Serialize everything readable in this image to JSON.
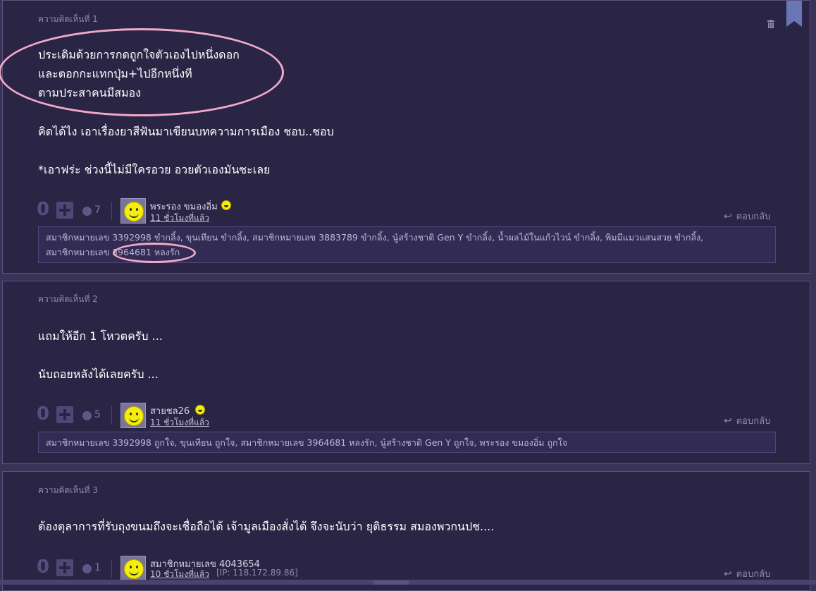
{
  "comments": [
    {
      "label": "ความคิดเห็นที่ 1",
      "lines": [
        "ประเดิมด้วยการกดถูกใจตัวเองไปหนึ่งดอก",
        "และตอกกะแทกปุ่ม+ไปอีกหนึ่งที",
        "ตามประสาคนมีสมอง",
        "คิดได้ไง เอาเรื่องยาสีฟันมาเขียนบทความการเมือง ชอบ..ชอบ",
        "*เอาฟร่ะ ช่วงนี้ไม่มีใครอวย อวยตัวเองมันซะเลย"
      ],
      "votes": "0",
      "emotion_count": "7",
      "username": "พระรอง ขมองอิ่ม",
      "time": "11 ชั่วโมงที่แล้ว",
      "reply_label": "ตอบกลับ",
      "emotion_list_line1": "สมาชิกหมายเลข 3392998 ขำกลิ้ง, ขุนเทียน ขำกลิ้ง, สมาชิกหมายเลข 3883789 ขำกลิ้ง, นู๋สร้างชาติ Gen Y ขำกลิ้ง, น้ำผลไม้ในแก้วไวน์ ขำกลิ้ง, พิมมีแมวแสนสวย ขำกลิ้ง,",
      "emotion_list_line2": "สมาชิกหมายเลข 3964681 หลงรัก"
    },
    {
      "label": "ความคิดเห็นที่ 2",
      "lines": [
        "แถมให้อีก 1 โหวตครับ ...",
        "นับถอยหลังได้เลยครับ ..."
      ],
      "votes": "0",
      "emotion_count": "5",
      "username": "สายชล26",
      "time": "11 ชั่วโมงที่แล้ว",
      "reply_label": "ตอบกลับ",
      "emotion_list_line1": "สมาชิกหมายเลข 3392998 ถูกใจ, ขุนเทียน ถูกใจ, สมาชิกหมายเลข 3964681 หลงรัก, นู๋สร้างชาติ Gen Y ถูกใจ, พระรอง ขมองอิ่ม ถูกใจ"
    },
    {
      "label": "ความคิดเห็นที่ 3",
      "lines": [
        "ต้องตุลาการที่รับถุงขนมถึงจะเชื่อถือได้ เจ้ามูลเมืองสั่งได้ จึงจะนับว่า ยุติธรรม  สมองพวกนปช...."
      ],
      "votes": "0",
      "emotion_count": "1",
      "username": "สมาชิกหมายเลข 4043654",
      "time": "10 ชั่วโมงที่แล้ว",
      "ip": "[IP: 118.172.89.86]",
      "reply_label": "ตอบกลับ"
    }
  ],
  "icons": {
    "trash": "trash-icon",
    "bookmark": "bookmark-icon",
    "plus": "plus-icon",
    "reply": "reply-arrow-icon",
    "emotion": "emotion-icon",
    "avatar": "smiley-avatar-icon",
    "laugh": "laugh-emoji-icon"
  },
  "colors": {
    "background": "#2b2545",
    "annotation": "#f2a9c9"
  }
}
